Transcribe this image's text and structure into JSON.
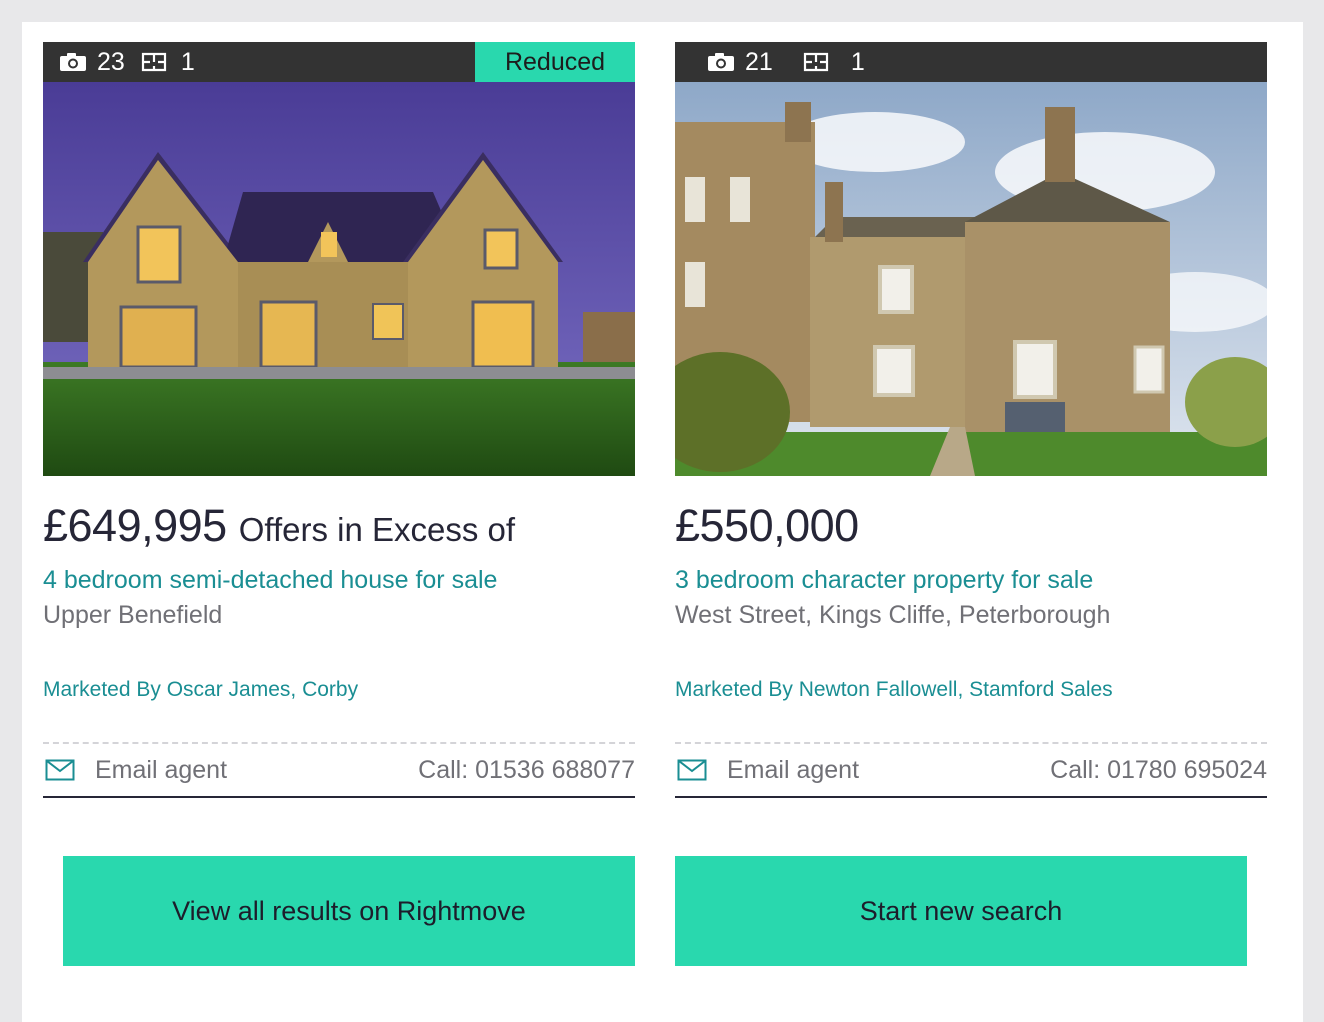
{
  "listings": [
    {
      "photo_count": "23",
      "floorplan_count": "1",
      "badge": "Reduced",
      "price": "£649,995",
      "price_qualifier": "Offers in Excess of",
      "title": "4 bedroom semi-detached house for sale",
      "address": "Upper Benefield",
      "marketed_by": "Marketed By Oscar James, Corby",
      "email_label": "Email agent",
      "call_label": "Call: 01536 688077"
    },
    {
      "photo_count": "21",
      "floorplan_count": "1",
      "badge": "",
      "price": "£550,000",
      "price_qualifier": "",
      "title": "3 bedroom character property for sale",
      "address": "West Street, Kings Cliffe, Peterborough",
      "marketed_by": "Marketed By Newton Fallowell, Stamford Sales",
      "email_label": "Email agent",
      "call_label": "Call: 01780 695024"
    }
  ],
  "buttons": {
    "view_all": "View all results on Rightmove",
    "new_search": "Start new search"
  },
  "colors": {
    "accent": "#29d8ae",
    "link": "#1a8e93",
    "dark": "#262637",
    "muted": "#707076",
    "bar": "#333333"
  },
  "icons": {
    "photos": "camera-icon",
    "floorplan": "floorplan-icon",
    "email": "envelope-icon"
  }
}
